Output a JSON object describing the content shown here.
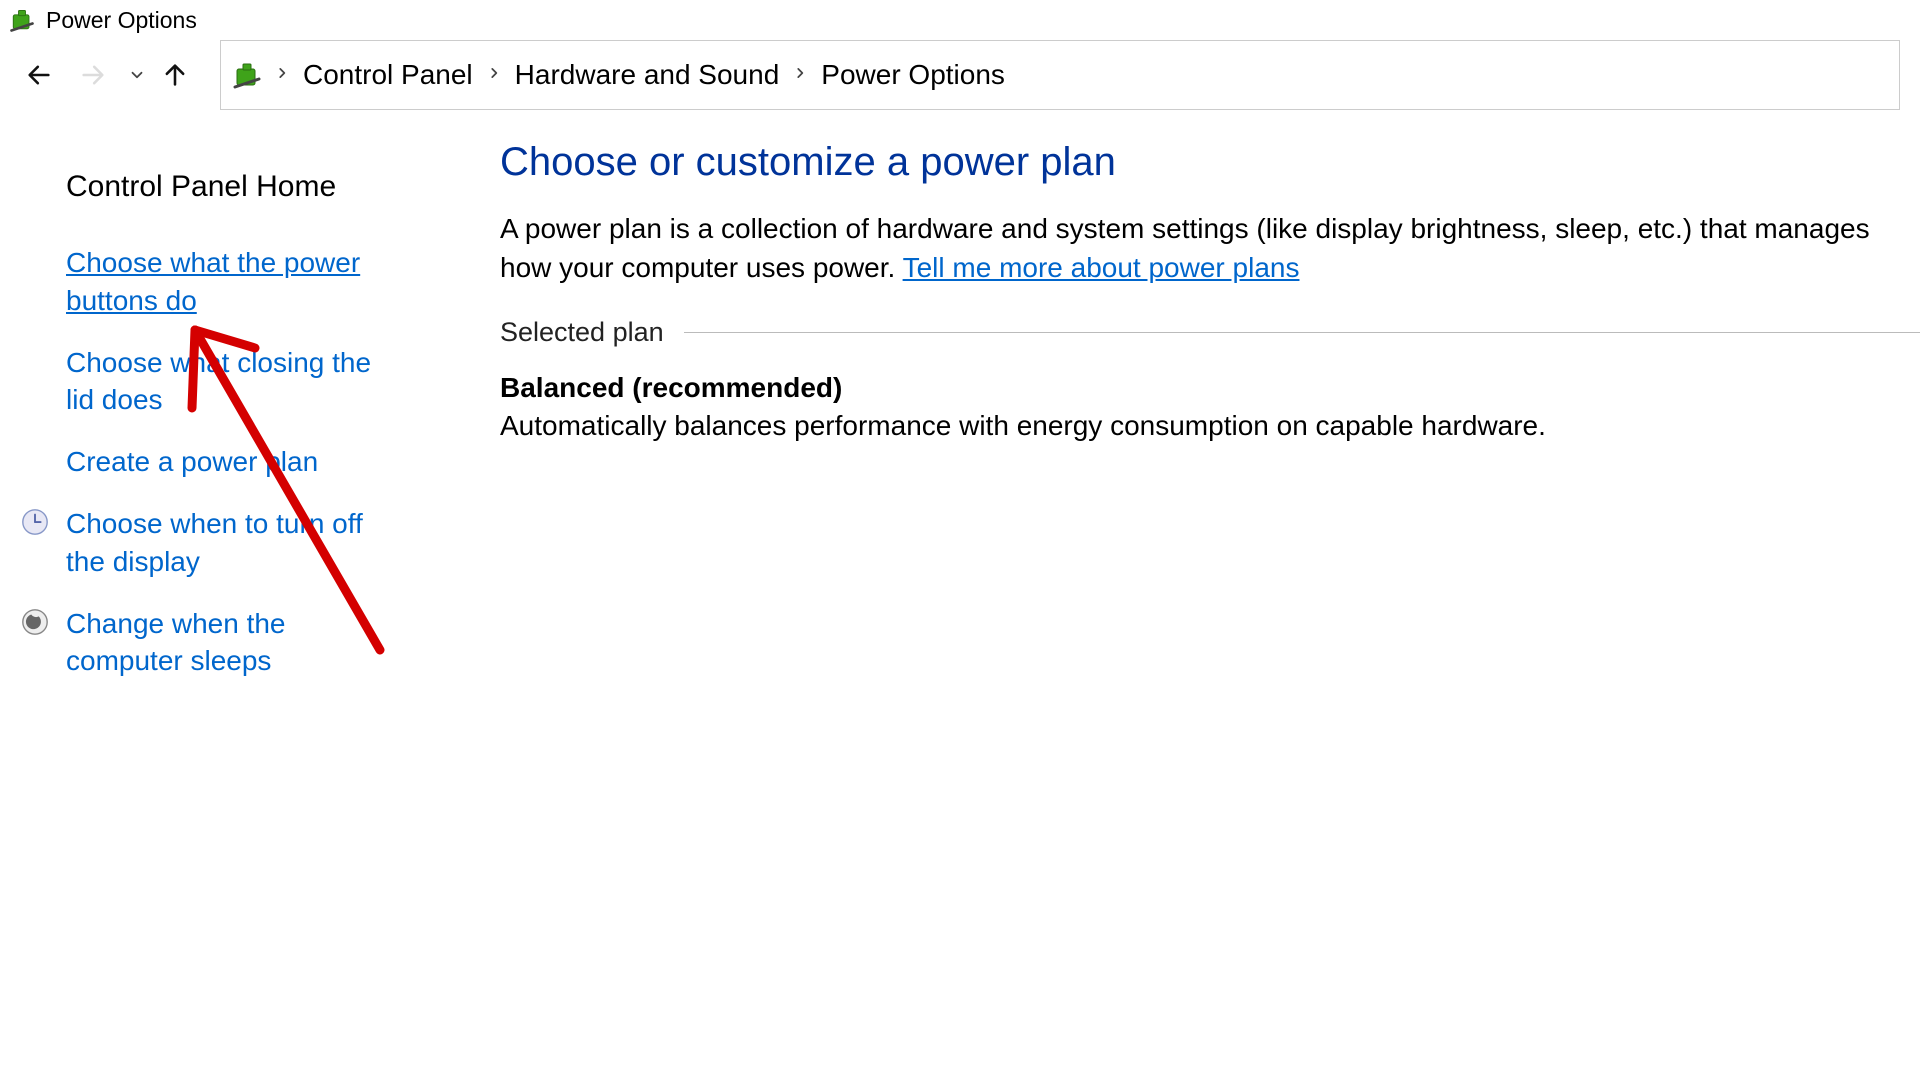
{
  "window": {
    "title": "Power Options"
  },
  "breadcrumbs": {
    "item0": "Control Panel",
    "item1": "Hardware and Sound",
    "item2": "Power Options"
  },
  "sidebar": {
    "home": "Control Panel Home",
    "items": [
      {
        "label": "Choose what the power buttons do",
        "active": true,
        "shield": false
      },
      {
        "label": "Choose what closing the lid does",
        "active": false,
        "shield": false
      },
      {
        "label": "Create a power plan",
        "active": false,
        "shield": false
      },
      {
        "label": "Choose when to turn off the display",
        "active": false,
        "shield": true
      },
      {
        "label": "Change when the computer sleeps",
        "active": false,
        "shield": true
      }
    ]
  },
  "main": {
    "heading": "Choose or customize a power plan",
    "description_prefix": "A power plan is a collection of hardware and system settings (like display brightness, sleep, etc.) that manages how your computer uses power. ",
    "description_link": "Tell me more about power plans",
    "selected_plan_label": "Selected plan",
    "plan_name": "Balanced (recommended)",
    "plan_desc": "Automatically balances performance with energy consumption on capable hardware."
  },
  "annotation": {
    "color": "#d40000"
  }
}
